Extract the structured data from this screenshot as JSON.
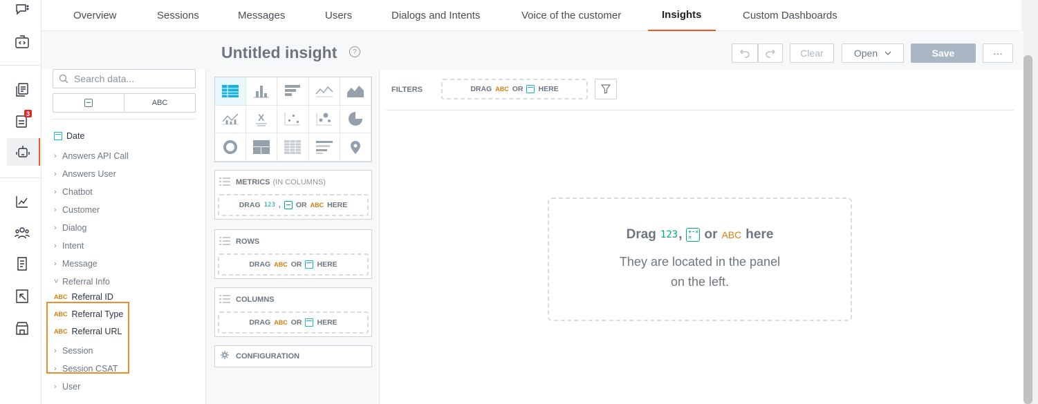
{
  "rail": {
    "items": [
      {
        "icon": "chat-icon"
      },
      {
        "icon": "code-icon"
      },
      {
        "icon": "copy-doc-icon"
      },
      {
        "icon": "tasks-icon",
        "badge": "3"
      },
      {
        "icon": "bot-icon"
      },
      {
        "icon": "analytics-icon"
      },
      {
        "icon": "people-icon"
      },
      {
        "icon": "document-icon"
      },
      {
        "icon": "export-icon"
      },
      {
        "icon": "store-icon"
      }
    ]
  },
  "nav": {
    "tabs": [
      "Overview",
      "Sessions",
      "Messages",
      "Users",
      "Dialogs and Intents",
      "Voice of the customer",
      "Insights",
      "Custom Dashboards"
    ],
    "active": "Insights"
  },
  "toolbar": {
    "title": "Untitled insight",
    "help": "?",
    "clear": "Clear",
    "open": "Open",
    "save": "Save",
    "more": "···"
  },
  "catalog": {
    "search_placeholder": "Search data...",
    "toggle_abc": "ABC",
    "date_item": "Date",
    "groups_before": [
      "Answers API Call",
      "Answers User",
      "Chatbot",
      "Customer",
      "Dialog",
      "Intent",
      "Message"
    ],
    "expanded_group": "Referral Info",
    "expanded_items": [
      "Referral ID",
      "Referral Type",
      "Referral URL"
    ],
    "groups_after": [
      "Session",
      "Session CSAT",
      "User"
    ],
    "abc_tag": "ABC"
  },
  "buckets": {
    "metrics_title": "METRICS",
    "metrics_hint": "(IN COLUMNS)",
    "rows_title": "ROWS",
    "columns_title": "COLUMNS",
    "config_title": "CONFIGURATION",
    "drag": "DRAG",
    "or": "OR",
    "here": "HERE",
    "comma": ",",
    "n123": "123",
    "abc": "ABC"
  },
  "canvas": {
    "filters_label": "FILTERS",
    "drag_word": "Drag",
    "n123": "123",
    "comma": ",",
    "or": "or",
    "abc": "ABC",
    "here": "here",
    "hint_line1": "They are located in the panel",
    "hint_line2": "on the left."
  },
  "colors": {
    "accent": "#f05a22",
    "highlight": "#f28c28",
    "numeric": "#00a97f",
    "attribute": "#d47f0e",
    "date": "#14b2e2",
    "save_disabled": "#a9b7c5"
  }
}
